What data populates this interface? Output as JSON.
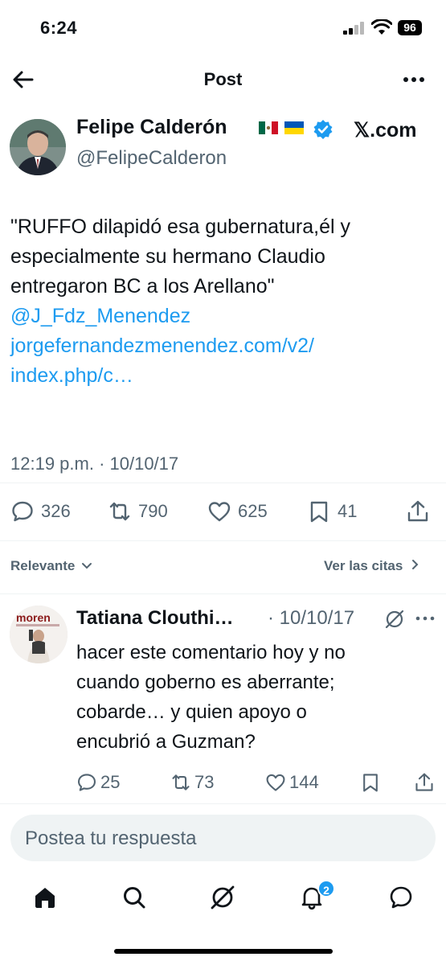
{
  "status_bar": {
    "time": "6:24",
    "battery": "96"
  },
  "nav": {
    "title": "Post"
  },
  "post": {
    "author_name": "Felipe Calderón",
    "author_handle": "@FelipeCalderon",
    "watermark": "𝕏.com",
    "text_lines": [
      "\"RUFFO dilapidó esa gubernatura,él y",
      "especialmente su hermano Claudio",
      "entregaron BC a los Arellano\""
    ],
    "mention": "@J_Fdz_Menendez",
    "link_lines": [
      "jorgefernandezmenendez.com/v2/",
      "index.php/c…"
    ],
    "meta": "12:19 p.m. · 10/10/17",
    "stats": {
      "replies": "326",
      "reposts": "790",
      "likes": "625",
      "bookmarks": "41"
    }
  },
  "sort": {
    "left_label": "Relevante",
    "right_label": "Ver las citas"
  },
  "reply": {
    "author_name": "Tatiana Clouthi…",
    "date": "· 10/10/17",
    "text_lines": [
      "hacer este comentario hoy y no",
      "cuando goberno es aberrante;",
      "cobarde… y quien apoyo o",
      "encubrió a Guzman?"
    ],
    "avatar_text": "moren",
    "stats": {
      "replies": "25",
      "reposts": "73",
      "likes": "144"
    }
  },
  "compose": {
    "placeholder": "Postea tu respuesta"
  },
  "tabbar": {
    "notifications_badge": "2"
  },
  "colors": {
    "accent": "#1d9bf0",
    "text": "#0f1419",
    "secondary": "#536471"
  }
}
